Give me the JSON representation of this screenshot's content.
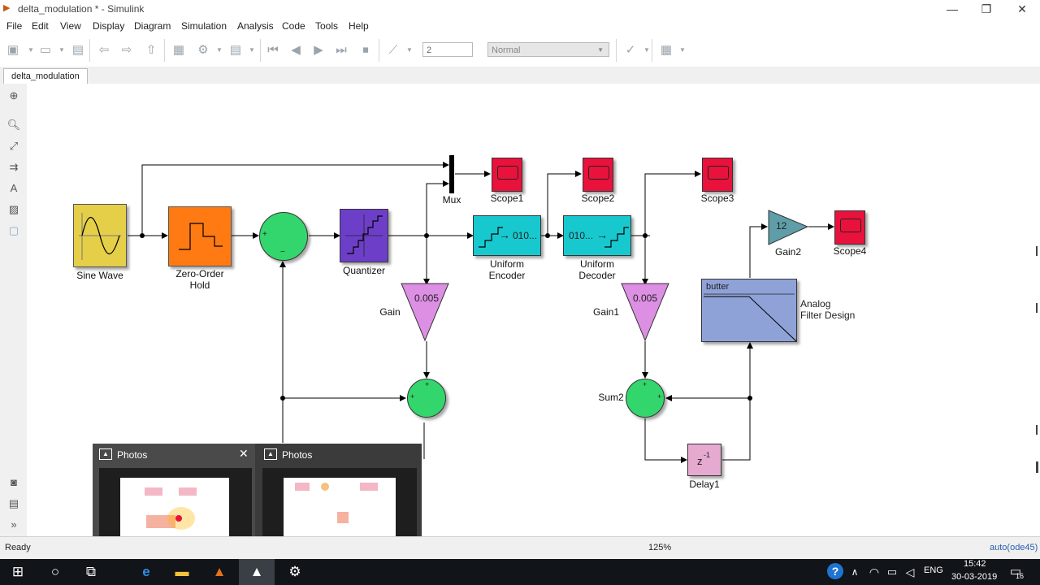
{
  "window": {
    "title": "delta_modulation * - Simulink",
    "minimize": "—",
    "restore": "❐",
    "close": "✕"
  },
  "menu": [
    "File",
    "Edit",
    "View",
    "Display",
    "Diagram",
    "Simulation",
    "Analysis",
    "Code",
    "Tools",
    "Help"
  ],
  "toolbar": {
    "stop_time": "2",
    "sim_mode": "Normal"
  },
  "tab": {
    "label": "delta_modulation"
  },
  "blocks": {
    "sine": "Sine Wave",
    "zoh": [
      "Zero-Order",
      "Hold"
    ],
    "quantizer": "Quantizer",
    "mux": "Mux",
    "scope1": "Scope1",
    "scope2": "Scope2",
    "scope3": "Scope3",
    "scope4": "Scope4",
    "encoder": [
      "Uniform",
      "Encoder"
    ],
    "encoder_text": "010...",
    "decoder": [
      "Uniform",
      "Decoder"
    ],
    "decoder_text": "010...",
    "gain": "Gain",
    "gain_value": "0.005",
    "gain1": "Gain1",
    "gain1_value": "0.005",
    "gain2": "Gain2",
    "gain2_value": "12",
    "sum2": "Sum2",
    "delay": "Delay1",
    "delay_text": "z",
    "delay_exp": "-1",
    "filter_text": "butter",
    "filter": [
      "Analog",
      "Filter Design"
    ],
    "sum_plus": "+",
    "sum_minus": "−"
  },
  "status": {
    "ready": "Ready",
    "zoom": "125%",
    "solver": "auto(ode45)"
  },
  "taskbar": {
    "time": "15:42",
    "date": "30-03-2019",
    "lang": "ENG",
    "notifications": "16"
  },
  "previews": [
    {
      "title": "Photos"
    },
    {
      "title": "Photos"
    }
  ],
  "colors": {
    "scope": "#e8123c",
    "encoder": "#17c9cf",
    "gain": "#dc8fe3",
    "sum": "#33d66d",
    "quantizer": "#6d3fc8",
    "zoh": "#ff7a12",
    "sine": "#e5cf48",
    "filter": "#8fa2d8",
    "gain2": "#5f9ea8",
    "delay": "#e6a9cf"
  }
}
